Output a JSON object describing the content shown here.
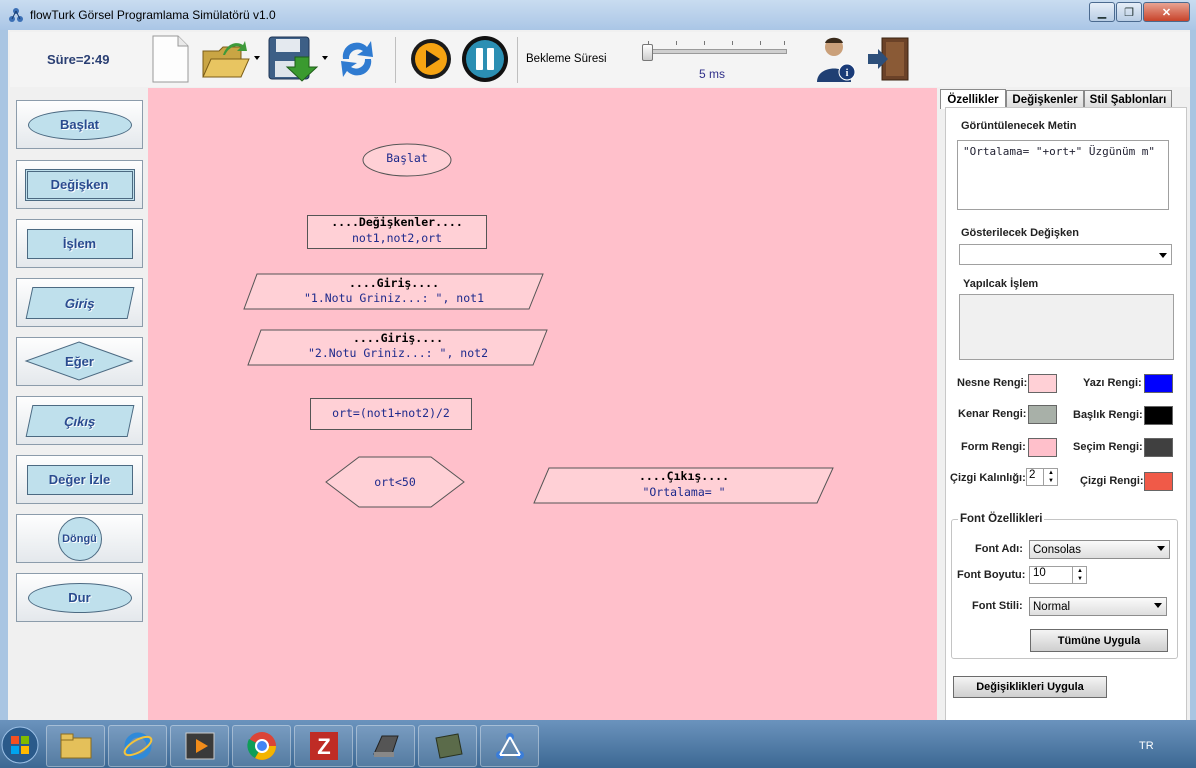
{
  "window": {
    "title": "flowTurk Görsel Programlama Simülatörü v1.0"
  },
  "toolbar": {
    "timer": "Süre=2:49",
    "delay_label": "Bekleme Süresi",
    "delay_value": "5 ms",
    "delay_level": 0.0
  },
  "palette": {
    "items": [
      {
        "label": "Başlat"
      },
      {
        "label": "Değişken"
      },
      {
        "label": "İşlem"
      },
      {
        "label": "Giriş"
      },
      {
        "label": "Eğer"
      },
      {
        "label": "Çıkış"
      },
      {
        "label": "Değer İzle"
      },
      {
        "label": "Döngü"
      },
      {
        "label": "Dur"
      }
    ]
  },
  "canvas": {
    "start_label": "Başlat",
    "variables_title": "....Değişkenler....",
    "variables_body": "not1,not2,ort",
    "input1_title": "....Giriş....",
    "input1_body": "\"1.Notu Griniz...: \", not1",
    "input2_title": "....Giriş....",
    "input2_body": "\"2.Notu Griniz...: \", not2",
    "process_body": "ort=(not1+not2)/2",
    "decision_body": "ort<50",
    "output_title": "....Çıkış....",
    "output_body": "\"Ortalama= \""
  },
  "tabs": {
    "properties": "Özellikler",
    "variables": "Değişkenler",
    "templates": "Stil Şablonları"
  },
  "properties": {
    "display_text_label": "Görüntülenecek Metin",
    "display_text_value": "\"Ortalama= \"+ort+\" Üzgünüm m\"",
    "shown_variable_label": "Gösterilecek Değişken",
    "shown_variable_value": "",
    "operation_label": "Yapılcak İşlem",
    "operation_value": "",
    "object_color_label": "Nesne Rengi:",
    "text_color_label": "Yazı Rengi:",
    "border_color_label": "Kenar Rengi:",
    "title_color_label": "Başlık Rengi:",
    "form_color_label": "Form Rengi:",
    "selection_color_label": "Seçim Rengi:",
    "line_width_label": "Çizgi Kalınlığı:",
    "line_width_value": "2",
    "line_color_label": "Çizgi Rengi:",
    "font_group_label": "Font Özellikleri",
    "font_name_label": "Font Adı:",
    "font_name_value": "Consolas",
    "font_size_label": "Font Boyutu:",
    "font_size_value": "10",
    "font_style_label": "Font Stili:",
    "font_style_value": "Normal",
    "apply_all_label": "Tümüne Uygula",
    "apply_changes_label": "Değişiklikleri Uygula"
  },
  "colors": {
    "object": "#ffd0d6",
    "text": "#0000ff",
    "border": "#a8b0a8",
    "title": "#000000",
    "form": "#ffc0cb",
    "selection": "#404040",
    "line": "#f05a48",
    "canvas": "#ffc0cb"
  },
  "taskbar": {
    "language": "TR",
    "icons": [
      "windows-start-icon",
      "file-explorer-icon",
      "internet-explorer-icon",
      "media-player-icon",
      "chrome-icon",
      "filezilla-icon",
      "app-icon",
      "app-icon",
      "network-icon"
    ]
  }
}
